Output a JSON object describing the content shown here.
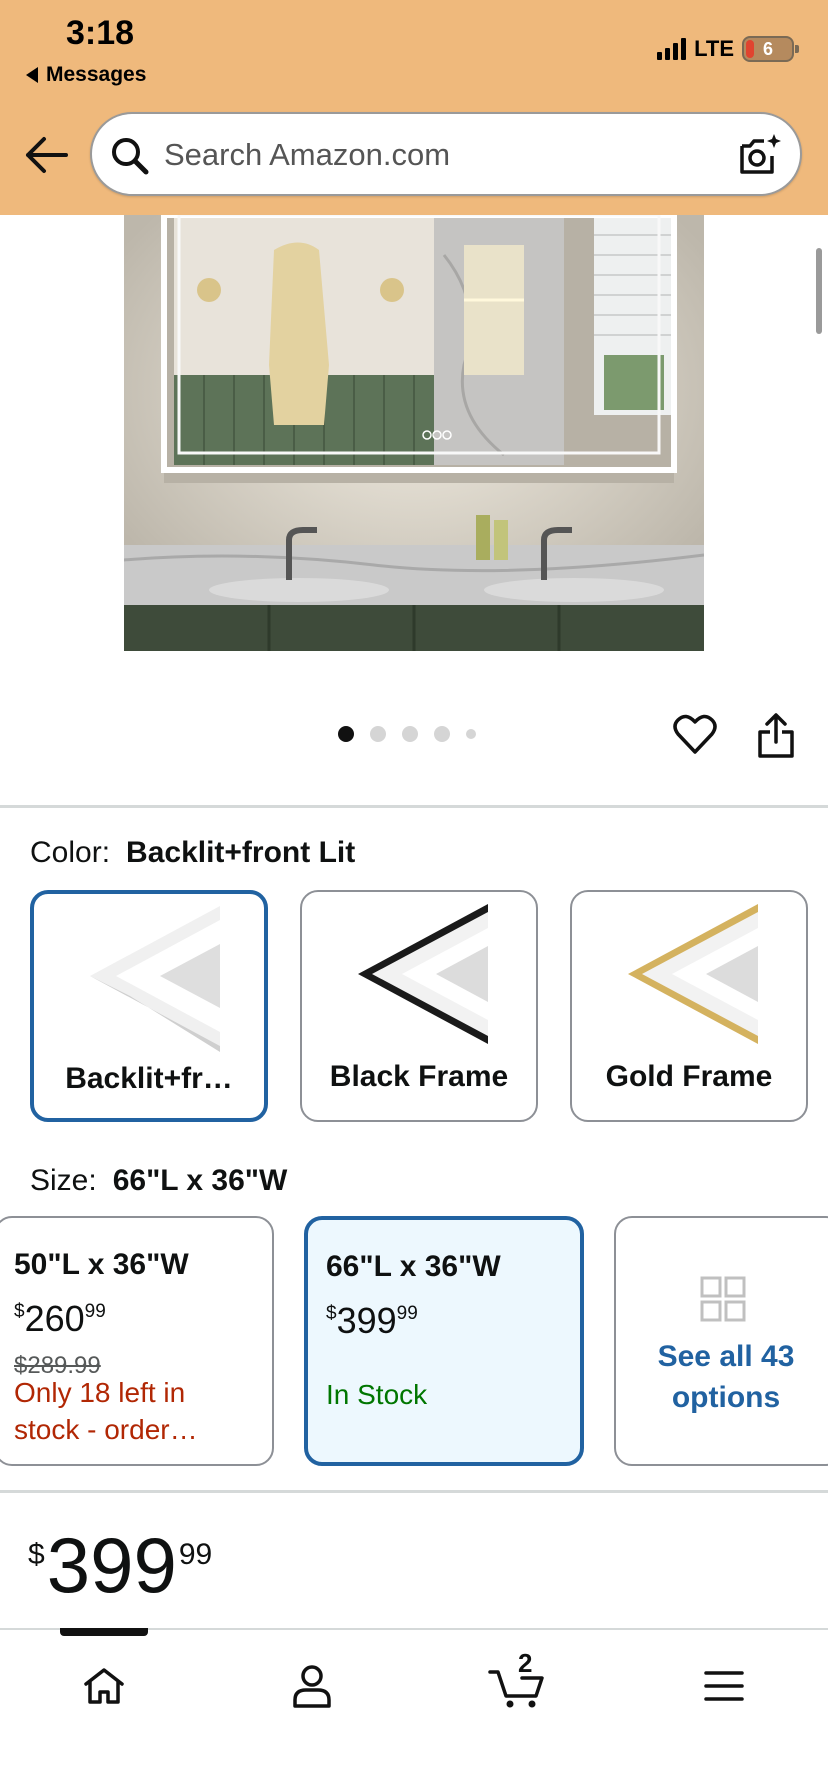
{
  "status_bar": {
    "time": "3:18",
    "back_app": "Messages",
    "network": "LTE",
    "battery": "6"
  },
  "search": {
    "placeholder": "Search Amazon.com"
  },
  "product_image": {
    "icon": "bathroom-led-mirror-image"
  },
  "carousel": {
    "dots": 5,
    "active_index": 0
  },
  "color": {
    "label": "Color:",
    "selected": "Backlit+front Lit",
    "options": [
      {
        "name": "Backlit+fr…",
        "frame_color": "#e6e6e6"
      },
      {
        "name": "Black Frame",
        "frame_color": "#1a1a1a"
      },
      {
        "name": "Gold Frame",
        "frame_color": "#d4b25f"
      }
    ]
  },
  "size": {
    "label": "Size:",
    "selected": "66\"L x 36\"W",
    "options": [
      {
        "dim": "50\"L x 36\"W",
        "price_whole": "260",
        "price_frac": "99",
        "list_price": "$289.99",
        "stock": "Only 18 left in stock - order…"
      },
      {
        "dim": "66\"L x 36\"W",
        "price_whole": "399",
        "price_frac": "99",
        "stock": "In Stock"
      }
    ],
    "see_all": "See all 43 options"
  },
  "price": {
    "symbol": "$",
    "whole": "399",
    "fraction": "99"
  },
  "bottom_nav": {
    "cart_count": "2"
  },
  "colors": {
    "header_bg": "#efb97c",
    "accent_blue": "#2162a1",
    "stock_red": "#b12704",
    "stock_green": "#007600"
  }
}
